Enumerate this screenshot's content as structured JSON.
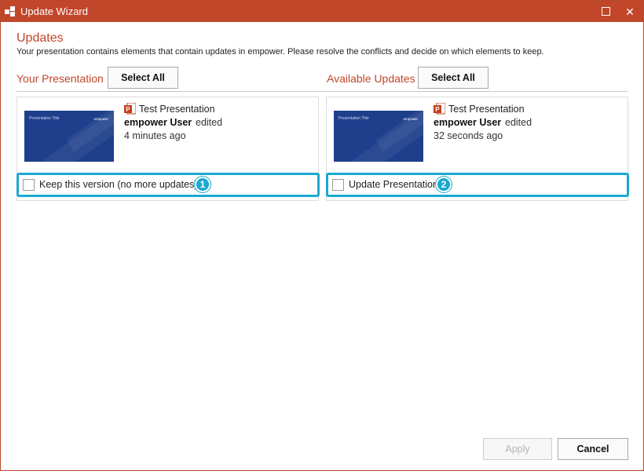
{
  "window": {
    "title": "Update Wizard"
  },
  "header": {
    "heading": "Updates",
    "description": "Your presentation contains elements that contain updates in empower. Please resolve the conflicts and decide on which elements to keep."
  },
  "left": {
    "section_label": "Your Presentation",
    "select_all_label": "Select All",
    "card": {
      "file_name": "Test Presentation",
      "user": "empower User",
      "action": "edited",
      "time": "4 minutes ago",
      "thumb_title": "Presentation Title",
      "thumb_brand": "empower"
    },
    "option_label": "Keep this version (no more updates)",
    "badge": "1"
  },
  "right": {
    "section_label": "Available Updates",
    "select_all_label": "Select All",
    "card": {
      "file_name": "Test Presentation",
      "user": "empower User",
      "action": "edited",
      "time": "32 seconds ago",
      "thumb_title": "Presentation Title",
      "thumb_brand": "empower"
    },
    "option_label": "Update Presentation",
    "badge": "2"
  },
  "footer": {
    "apply_label": "Apply",
    "cancel_label": "Cancel"
  },
  "colors": {
    "titlebar": "#c1462a",
    "accent": "#c1462a",
    "highlight": "#1aa9cf",
    "thumbnail": "#1e3f8c"
  }
}
